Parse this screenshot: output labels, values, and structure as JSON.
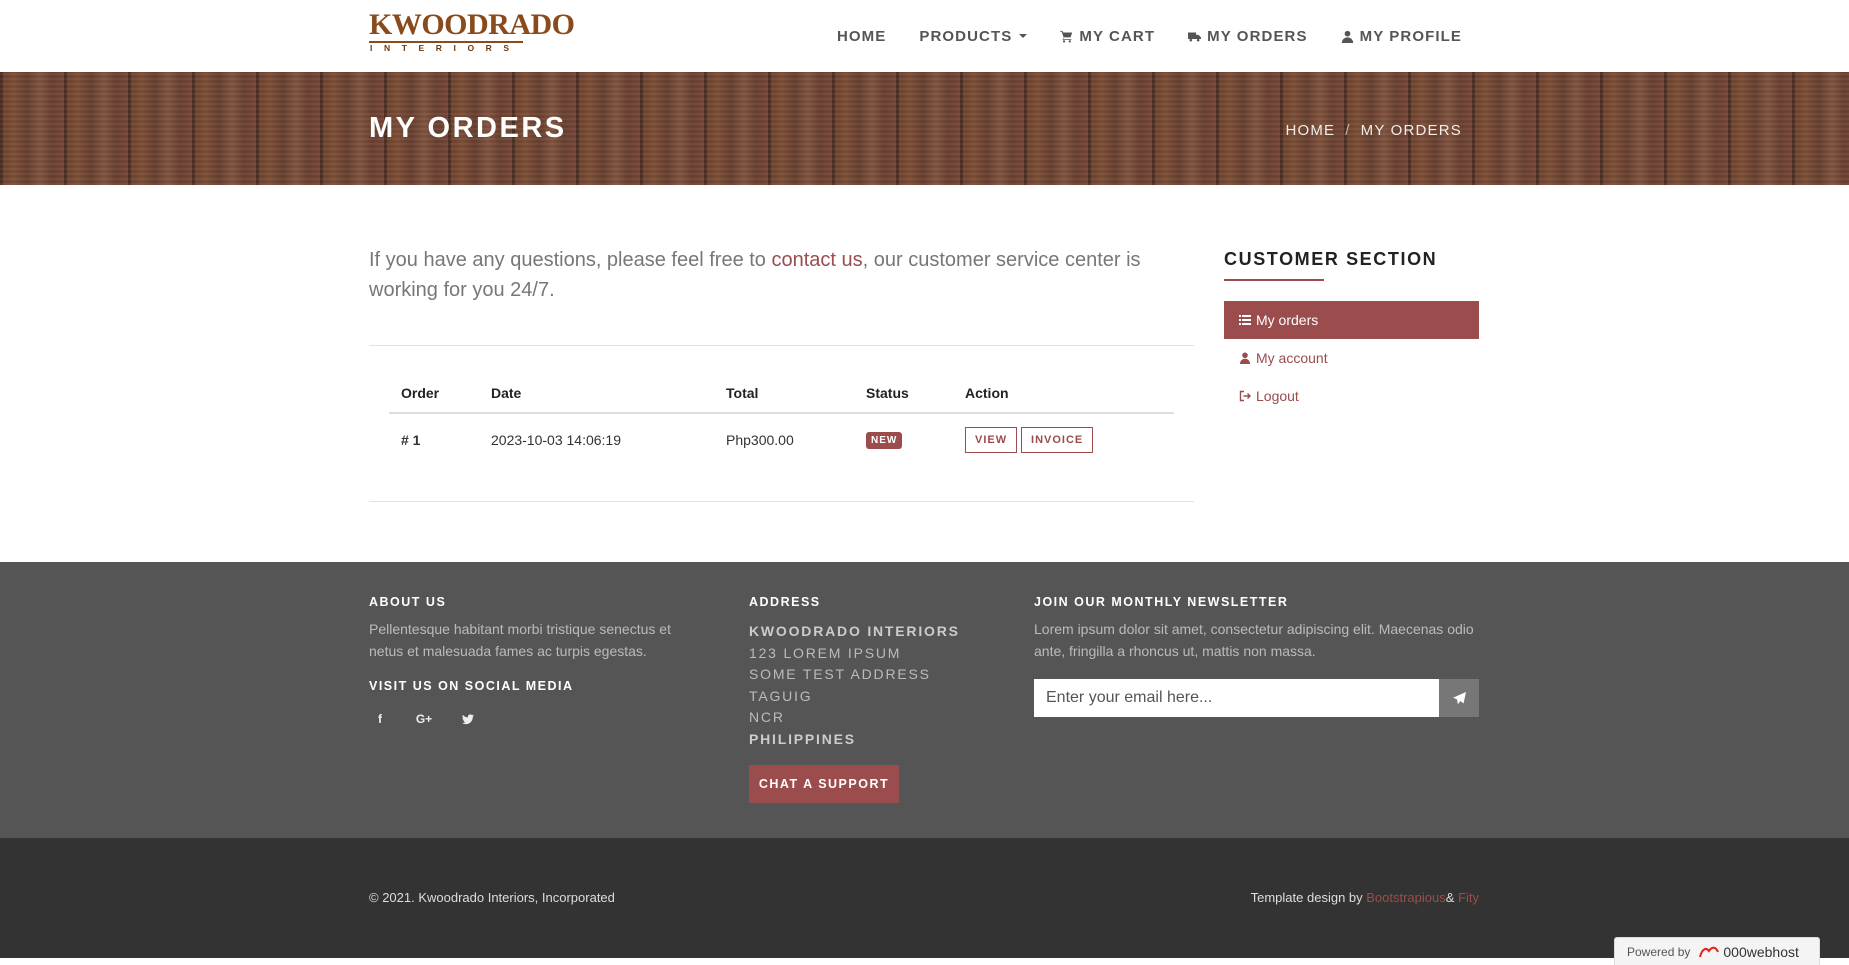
{
  "brand": {
    "logo_main": "KWOODRADO",
    "logo_sub": "INTERIORS"
  },
  "nav": {
    "home": "HOME",
    "products": "PRODUCTS",
    "cart": "MY CART",
    "orders": "MY ORDERS",
    "profile": "MY PROFILE"
  },
  "banner": {
    "title": "MY ORDERS",
    "breadcrumb_home": "HOME",
    "breadcrumb_current": "MY ORDERS"
  },
  "intro": {
    "before": "If you have any questions, please feel free to ",
    "link": "contact us",
    "after": ", our customer service center is working for you 24/7."
  },
  "table": {
    "headers": [
      "Order",
      "Date",
      "Total",
      "Status",
      "Action"
    ],
    "rows": [
      {
        "order": "# 1",
        "date": "2023-10-03 14:06:19",
        "total": "Php300.00",
        "status": "NEW",
        "view": "VIEW",
        "invoice": "INVOICE"
      }
    ]
  },
  "sidebar": {
    "title": "CUSTOMER SECTION",
    "items": [
      {
        "label": "My orders",
        "icon": "list-icon",
        "active": true
      },
      {
        "label": "My account",
        "icon": "user-icon",
        "active": false
      },
      {
        "label": "Logout",
        "icon": "sign-out-icon",
        "active": false
      }
    ]
  },
  "footer": {
    "about_title": "ABOUT US",
    "about_text": "Pellentesque habitant morbi tristique senectus et netus et malesuada fames ac turpis egestas.",
    "social_title": "VISIT US ON SOCIAL MEDIA",
    "social": [
      "facebook-icon",
      "google-plus-icon",
      "twitter-icon"
    ],
    "address_title": "ADDRESS",
    "address_lines": [
      "KWOODRADO INTERIORS",
      "123 LOREM IPSUM",
      "SOME TEST ADDRESS",
      "TAGUIG",
      "NCR",
      "PHILIPPINES"
    ],
    "chat_button": "CHAT A SUPPORT",
    "newsletter_title": "JOIN OUR MONTHLY NEWSLETTER",
    "newsletter_text": "Lorem ipsum dolor sit amet, consectetur adipiscing elit. Maecenas odio ante, fringilla a rhoncus ut, mattis non massa.",
    "newsletter_placeholder": "Enter your email here..."
  },
  "copyright": {
    "left": "© 2021. Kwoodrado Interiors, Incorporated",
    "right_prefix": "Template design by ",
    "link1": "Bootstrapious",
    "amp": "& ",
    "link2": "Fity"
  },
  "powered": {
    "label": "Powered by",
    "brand": "000webhost"
  },
  "colors": {
    "accent": "#9b4c4c",
    "footer_bg": "#555555",
    "copyright_bg": "#333333",
    "logo_brown": "#8a4b1c"
  }
}
